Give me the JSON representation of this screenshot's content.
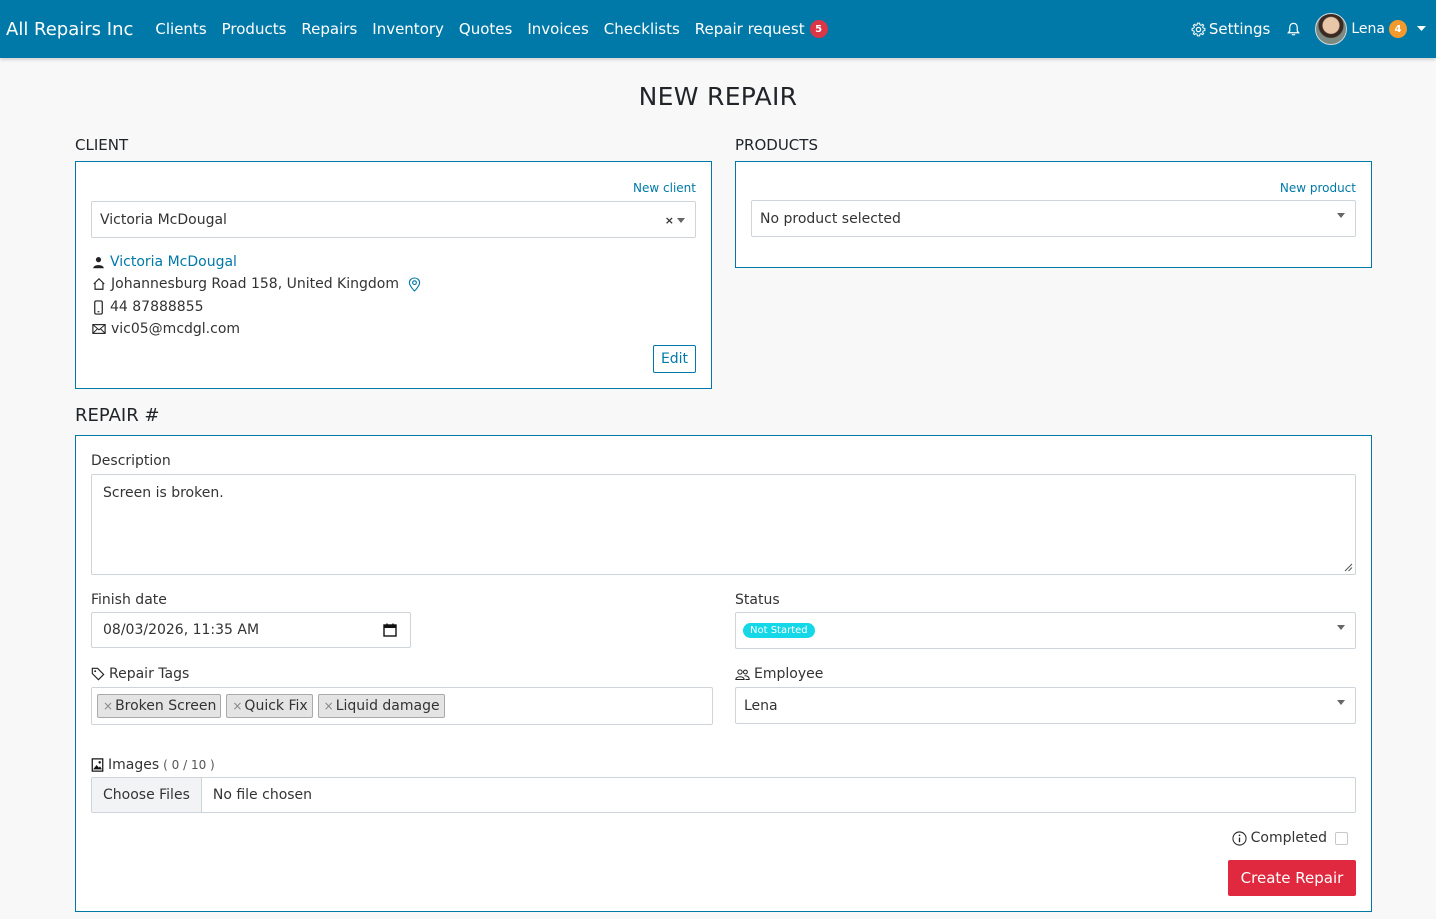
{
  "nav": {
    "brand": "All Repairs Inc",
    "links": [
      "Clients",
      "Products",
      "Repairs",
      "Inventory",
      "Quotes",
      "Invoices",
      "Checklists"
    ],
    "repair_request_label": "Repair request",
    "repair_request_count": "5",
    "settings_label": "Settings",
    "user_name": "Lena",
    "user_badge": "4"
  },
  "page_title": "NEW REPAIR",
  "client": {
    "section_title": "CLIENT",
    "new_client_label": "New client",
    "selected": "Victoria McDougal",
    "clear_symbol": "×",
    "name": "Victoria McDougal",
    "address": "Johannesburg Road 158, United Kingdom",
    "phone": "44 87888855",
    "email": "vic05@mcdgl.com",
    "edit_label": "Edit"
  },
  "products": {
    "section_title": "PRODUCTS",
    "new_product_label": "New product",
    "selected": "No product selected"
  },
  "repair": {
    "section_title": "REPAIR #",
    "description_label": "Description",
    "description_value": "Screen is broken.",
    "finish_date_label": "Finish date",
    "finish_date_value": "08/03/2026, 11:35 AM",
    "status_label": "Status",
    "status_value": "Not Started",
    "tags_label": "Repair Tags",
    "tags": [
      "Broken Screen",
      "Quick Fix",
      "Liquid damage"
    ],
    "tag_remove_symbol": "×",
    "employee_label": "Employee",
    "employee_value": "Lena",
    "images_label": "Images",
    "images_count": "( 0 / 10 )",
    "choose_files_label": "Choose Files",
    "no_file_label": "No file chosen",
    "completed_label": "Completed",
    "completed_checked": false,
    "create_label": "Create Repair"
  },
  "colors": {
    "primary": "#0179a8",
    "danger": "#e0283e",
    "status_not_started": "#14d8e8",
    "badge_orange": "#f39a2c"
  }
}
